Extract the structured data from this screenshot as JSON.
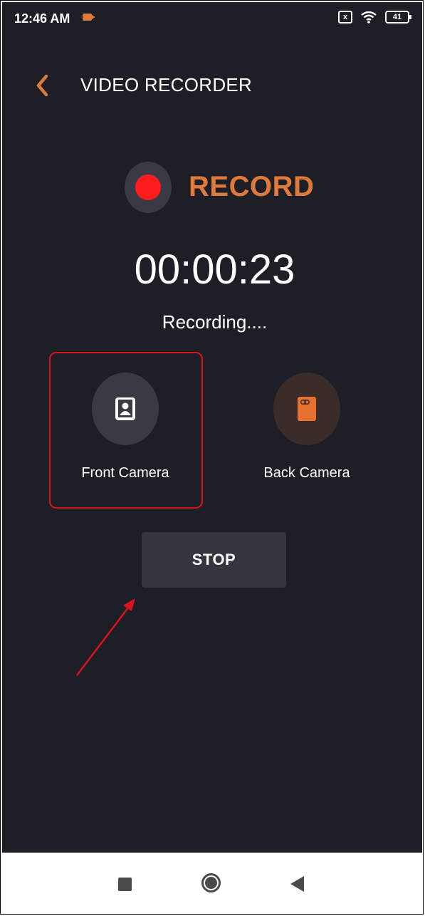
{
  "status_bar": {
    "time": "12:46 AM",
    "battery": "41",
    "sim_icon": "x",
    "recording_indicator_icon": "video-recording-icon",
    "wifi_icon": "wifi-icon"
  },
  "header": {
    "title": "VIDEO RECORDER",
    "back_icon": "chevron-left-icon"
  },
  "record": {
    "label": "RECORD",
    "timer": "00:00:23",
    "status": "Recording...."
  },
  "cameras": {
    "front": {
      "label": "Front Camera",
      "icon": "front-camera-icon"
    },
    "back": {
      "label": "Back Camera",
      "icon": "back-camera-icon"
    }
  },
  "controls": {
    "stop_label": "STOP"
  },
  "colors": {
    "background": "#1e1e26",
    "accent": "#e07a3a",
    "record_red": "#ff1c1c",
    "highlight": "#d9121b"
  },
  "navbar": {
    "recents_icon": "square-icon",
    "home_icon": "circle-icon",
    "back_icon": "triangle-back-icon"
  }
}
